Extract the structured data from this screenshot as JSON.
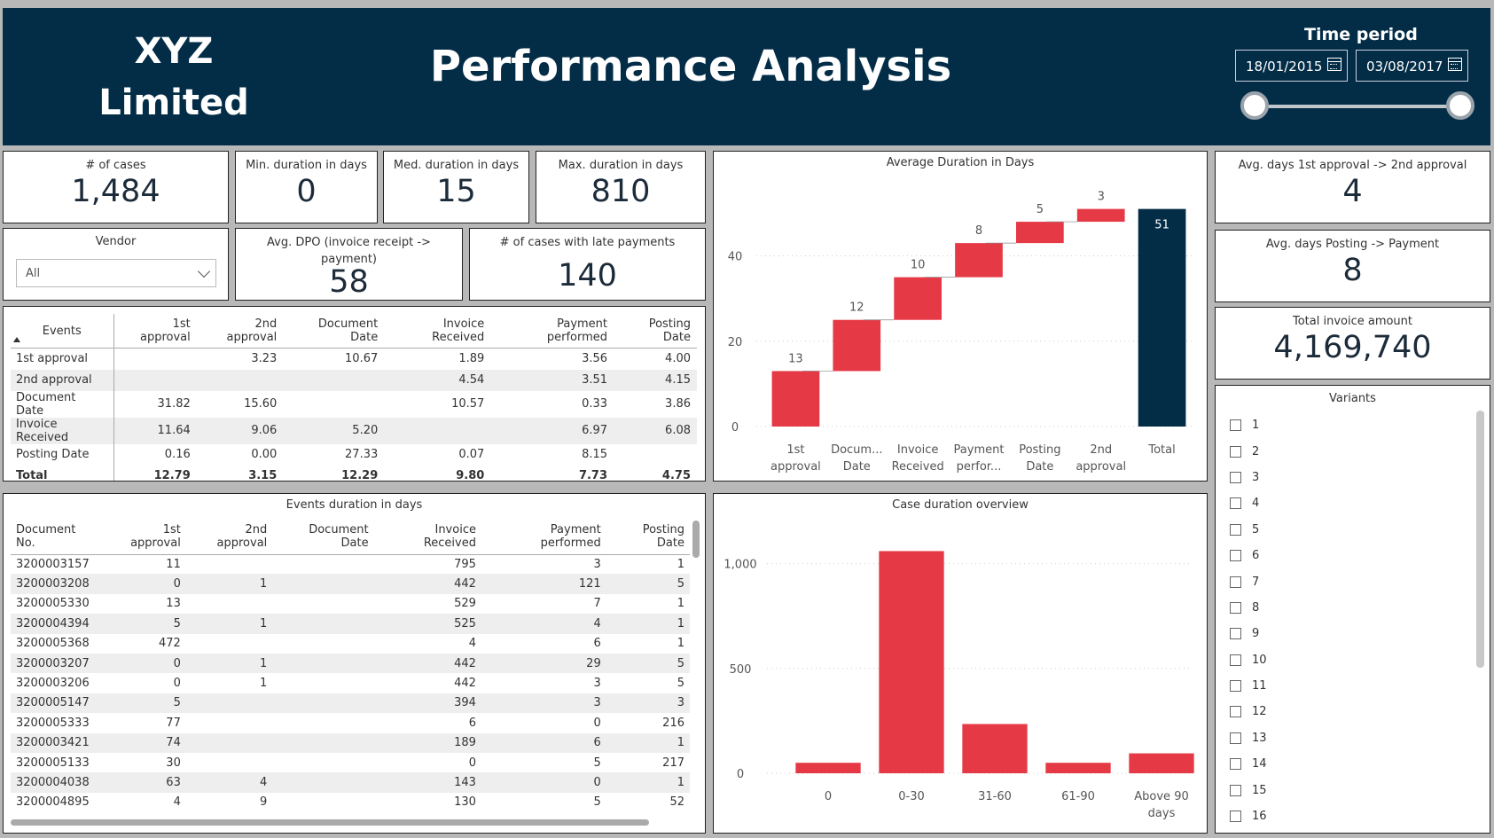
{
  "header": {
    "company": "XYZ Limited",
    "title": "Performance Analysis",
    "time_period_label": "Time period",
    "date_start": "18/01/2015",
    "date_end": "03/08/2017"
  },
  "kpis": {
    "cases": {
      "label": "# of cases",
      "value": "1,484"
    },
    "min_duration": {
      "label": "Min. duration in days",
      "value": "0"
    },
    "med_duration": {
      "label": "Med. duration in days",
      "value": "15"
    },
    "max_duration": {
      "label": "Max. duration in days",
      "value": "810"
    },
    "avg_dpo": {
      "label": "Avg. DPO (invoice receipt -> payment)",
      "value": "58"
    },
    "late_payments": {
      "label": "# of cases with late payments",
      "value": "140"
    },
    "avg_1st_2nd": {
      "label": "Avg. days 1st approval -> 2nd approval",
      "value": "4"
    },
    "avg_post_pay": {
      "label": "Avg. days Posting -> Payment",
      "value": "8"
    },
    "total_invoice": {
      "label": "Total invoice amount",
      "value": "4,169,740"
    }
  },
  "vendor": {
    "label": "Vendor",
    "value": "All"
  },
  "matrix": {
    "headers": [
      "Events",
      "1st approval",
      "2nd approval",
      "Document Date",
      "Invoice Received",
      "Payment performed",
      "Posting Date"
    ],
    "rows": [
      [
        "1st approval",
        "",
        "3.23",
        "10.67",
        "1.89",
        "3.56",
        "4.00"
      ],
      [
        "2nd approval",
        "",
        "",
        "",
        "4.54",
        "3.51",
        "4.15"
      ],
      [
        "Document Date",
        "31.82",
        "15.60",
        "",
        "10.57",
        "0.33",
        "3.86"
      ],
      [
        "Invoice Received",
        "11.64",
        "9.06",
        "5.20",
        "",
        "6.97",
        "6.08"
      ],
      [
        "Posting Date",
        "0.16",
        "0.00",
        "27.33",
        "0.07",
        "8.15",
        ""
      ],
      [
        "Total",
        "12.79",
        "3.15",
        "12.29",
        "9.80",
        "7.73",
        "4.75"
      ]
    ]
  },
  "events_table": {
    "title": "Events duration in days",
    "headers": [
      "Document No.",
      "1st approval",
      "2nd approval",
      "Document Date",
      "Invoice Received",
      "Payment performed",
      "Posting Date"
    ],
    "rows": [
      [
        "3200003157",
        "11",
        "",
        "",
        "795",
        "3",
        "1"
      ],
      [
        "3200003208",
        "0",
        "1",
        "",
        "442",
        "121",
        "5"
      ],
      [
        "3200005330",
        "13",
        "",
        "",
        "529",
        "7",
        "1"
      ],
      [
        "3200004394",
        "5",
        "1",
        "",
        "525",
        "4",
        "1"
      ],
      [
        "3200005368",
        "472",
        "",
        "",
        "4",
        "6",
        "1"
      ],
      [
        "3200003207",
        "0",
        "1",
        "",
        "442",
        "29",
        "5"
      ],
      [
        "3200003206",
        "0",
        "1",
        "",
        "442",
        "3",
        "5"
      ],
      [
        "3200005147",
        "5",
        "",
        "",
        "394",
        "3",
        "3"
      ],
      [
        "3200005333",
        "77",
        "",
        "",
        "6",
        "0",
        "216"
      ],
      [
        "3200003421",
        "74",
        "",
        "",
        "189",
        "6",
        "1"
      ],
      [
        "3200005133",
        "30",
        "",
        "",
        "0",
        "5",
        "217"
      ],
      [
        "3200004038",
        "63",
        "4",
        "",
        "143",
        "0",
        "1"
      ],
      [
        "3200004895",
        "4",
        "9",
        "",
        "130",
        "5",
        "52"
      ]
    ]
  },
  "variants": {
    "label": "Variants",
    "items": [
      "1",
      "2",
      "3",
      "4",
      "5",
      "6",
      "7",
      "8",
      "9",
      "10",
      "11",
      "12",
      "13",
      "14",
      "15",
      "16"
    ]
  },
  "colors": {
    "navy": "#032d47",
    "red": "#e63946"
  },
  "chart_data": [
    {
      "type": "waterfall",
      "title": "Average Duration in Days",
      "categories": [
        "1st approval",
        "Docum... Date",
        "Invoice Received",
        "Payment perfor...",
        "Posting Date",
        "2nd approval",
        "Total"
      ],
      "values": [
        13,
        12,
        10,
        8,
        5,
        3,
        51
      ],
      "yticks": [
        0,
        20,
        40
      ],
      "ylim": [
        0,
        53
      ]
    },
    {
      "type": "bar",
      "title": "Case duration overview",
      "categories": [
        "0",
        "0-30",
        "31-60",
        "61-90",
        "Above 90 days"
      ],
      "values": [
        50,
        1060,
        235,
        50,
        95
      ],
      "yticks": [
        0,
        500,
        1000
      ],
      "ytick_labels": [
        "0",
        "500",
        "1,000"
      ],
      "ylim": [
        0,
        1100
      ]
    }
  ]
}
